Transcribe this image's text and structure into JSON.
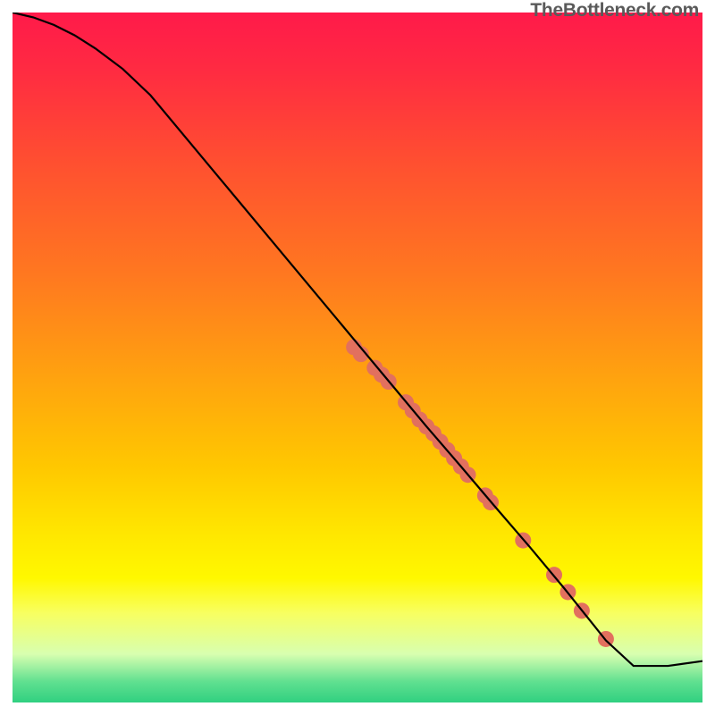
{
  "watermark": "TheBottleneck.com",
  "chart_data": {
    "type": "line",
    "title": "",
    "xlabel": "",
    "ylabel": "",
    "xlim": [
      0,
      100
    ],
    "ylim": [
      0,
      100
    ],
    "axes_visible": false,
    "background_gradient": {
      "stops": [
        {
          "pos": 0,
          "color": "#ff1a4a"
        },
        {
          "pos": 22,
          "color": "#ff5030"
        },
        {
          "pos": 52,
          "color": "#ffa010"
        },
        {
          "pos": 76,
          "color": "#ffe800"
        },
        {
          "pos": 93,
          "color": "#d8ffb0"
        },
        {
          "pos": 100,
          "color": "#30d080"
        }
      ]
    },
    "series": [
      {
        "name": "curve",
        "stroke": "#000000",
        "x": [
          0,
          3,
          6,
          9,
          12,
          16,
          20,
          30,
          40,
          50,
          55,
          60,
          65,
          70,
          75,
          80,
          82,
          84,
          86,
          90,
          95,
          100
        ],
        "y": [
          100,
          99.3,
          98.2,
          96.7,
          94.8,
          91.8,
          88,
          76,
          64,
          52,
          46,
          40,
          34.2,
          28.3,
          22.5,
          16.5,
          14,
          11.5,
          9,
          5.3,
          5.3,
          6.0
        ]
      }
    ],
    "markers": {
      "name": "highlight-dots",
      "color": "#e2705e",
      "radius": 9,
      "points_xy": [
        [
          49.5,
          51.5
        ],
        [
          50.5,
          50.5
        ],
        [
          52.5,
          48.5
        ],
        [
          53.5,
          47.5
        ],
        [
          54.5,
          46.5
        ],
        [
          57.0,
          43.5
        ],
        [
          58.0,
          42.3
        ],
        [
          59.0,
          41.0
        ],
        [
          60.0,
          40.0
        ],
        [
          61.0,
          39.0
        ],
        [
          62.0,
          37.8
        ],
        [
          63.0,
          36.6
        ],
        [
          64.0,
          35.4
        ],
        [
          65.0,
          34.2
        ],
        [
          66.0,
          33.0
        ],
        [
          68.5,
          30.0
        ],
        [
          69.3,
          29.0
        ],
        [
          74.0,
          23.5
        ],
        [
          78.5,
          18.5
        ],
        [
          80.5,
          16.0
        ],
        [
          82.5,
          13.3
        ],
        [
          86.0,
          9.2
        ]
      ]
    }
  }
}
